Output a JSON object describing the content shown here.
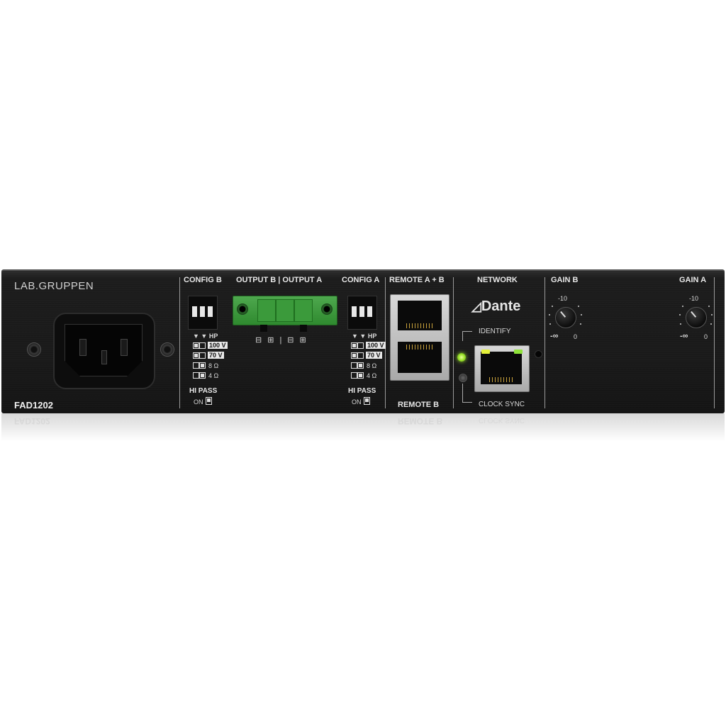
{
  "brand": {
    "logo": "LAB.GRUPPEN",
    "model": "FAD1202"
  },
  "sections": {
    "config_b": "CONFIG B",
    "output": "OUTPUT B | OUTPUT A",
    "config_a": "CONFIG A",
    "remote_ab": "REMOTE A + B",
    "remote_b": "REMOTE B",
    "network": "NETWORK",
    "gain_b": "GAIN B",
    "gain_a": "GAIN A"
  },
  "config": {
    "hp_label": "▼ ▼ HP",
    "modes": [
      "100 V",
      "70 V",
      "8 Ω",
      "4 Ω"
    ],
    "hi_pass": "HI PASS",
    "on": "ON"
  },
  "output_polarity": [
    "⊟",
    "⊞",
    "|",
    "⊟",
    "⊞"
  ],
  "network": {
    "dante": "Dante",
    "identify": "IDENTIFY",
    "clock_sync": "CLOCK SYNC",
    "led_color": "#9be22b"
  },
  "gain": {
    "top": "-10",
    "min": "-∞",
    "max": "0"
  },
  "reflection": {
    "model": "FAD1202",
    "remote_b": "REMOTE B",
    "clock_sync": "CLOCK SYNC"
  }
}
